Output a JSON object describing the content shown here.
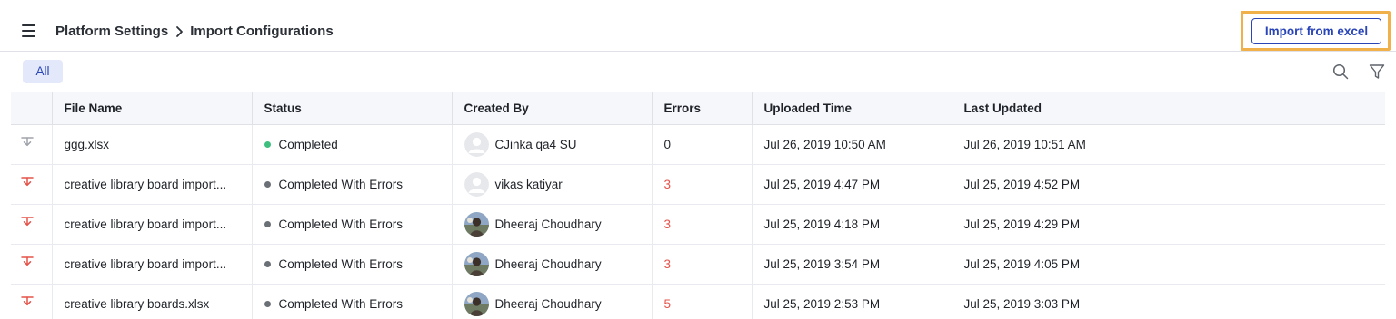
{
  "header": {
    "breadcrumb": [
      "Platform Settings",
      "Import Configurations"
    ],
    "import_button_label": "Import from excel"
  },
  "toolbar": {
    "filter_tab_label": "All"
  },
  "table": {
    "columns": [
      "File Name",
      "Status",
      "Created By",
      "Errors",
      "Uploaded Time",
      "Last Updated"
    ],
    "rows": [
      {
        "file_name": "ggg.xlsx",
        "status": "Completed",
        "status_color": "#3fbf7f",
        "created_by": "CJinka qa4 SU",
        "avatar": "placeholder",
        "errors": "0",
        "errors_highlight": false,
        "uploaded_time": "Jul 26, 2019 10:50 AM",
        "last_updated": "Jul 26, 2019 10:51 AM",
        "download_icon_color": "#a0a4ab"
      },
      {
        "file_name": "creative library board import...",
        "status": "Completed With Errors",
        "status_color": "#6b6f76",
        "created_by": "vikas katiyar",
        "avatar": "placeholder",
        "errors": "3",
        "errors_highlight": true,
        "uploaded_time": "Jul 25, 2019 4:47 PM",
        "last_updated": "Jul 25, 2019 4:52 PM",
        "download_icon_color": "#e5534b"
      },
      {
        "file_name": "creative library board import...",
        "status": "Completed With Errors",
        "status_color": "#6b6f76",
        "created_by": "Dheeraj Choudhary",
        "avatar": "photo",
        "errors": "3",
        "errors_highlight": true,
        "uploaded_time": "Jul 25, 2019 4:18 PM",
        "last_updated": "Jul 25, 2019 4:29 PM",
        "download_icon_color": "#e5534b"
      },
      {
        "file_name": "creative library board import...",
        "status": "Completed With Errors",
        "status_color": "#6b6f76",
        "created_by": "Dheeraj Choudhary",
        "avatar": "photo",
        "errors": "3",
        "errors_highlight": true,
        "uploaded_time": "Jul 25, 2019 3:54 PM",
        "last_updated": "Jul 25, 2019 4:05 PM",
        "download_icon_color": "#e5534b"
      },
      {
        "file_name": "creative library boards.xlsx",
        "status": "Completed With Errors",
        "status_color": "#6b6f76",
        "created_by": "Dheeraj Choudhary",
        "avatar": "photo",
        "errors": "5",
        "errors_highlight": true,
        "uploaded_time": "Jul 25, 2019 2:53 PM",
        "last_updated": "Jul 25, 2019 3:03 PM",
        "download_icon_color": "#e5534b"
      }
    ]
  },
  "icons": {
    "menu": "hamburger-menu-icon",
    "breadcrumb_separator": "chevron-right-icon",
    "search": "search-icon",
    "filter": "filter-funnel-icon",
    "row_download": "download-icon",
    "avatar_placeholder": "user-avatar-icon"
  },
  "colors": {
    "accent": "#2a45b8",
    "highlight_outline": "#f0b14a",
    "error": "#e5534b",
    "success": "#3fbf7f",
    "pill_background": "#e3e9fb"
  }
}
